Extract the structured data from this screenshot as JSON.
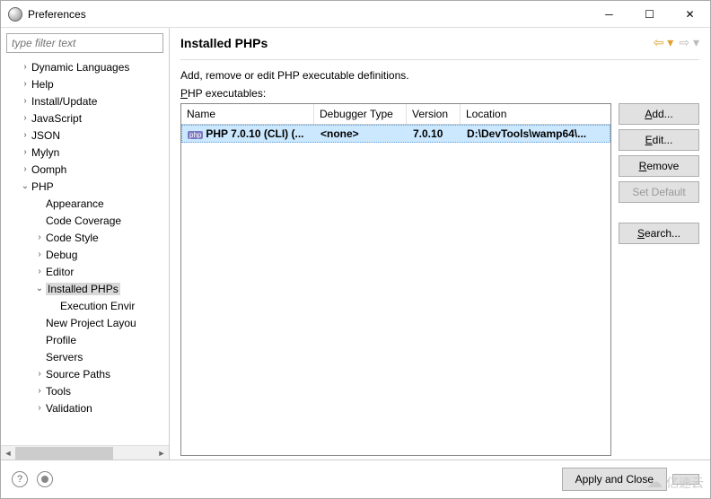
{
  "window": {
    "title": "Preferences"
  },
  "filter": {
    "placeholder": "type filter text"
  },
  "tree": [
    {
      "label": "Dynamic Languages",
      "level": 1,
      "expand": ">"
    },
    {
      "label": "Help",
      "level": 1,
      "expand": ">"
    },
    {
      "label": "Install/Update",
      "level": 1,
      "expand": ">"
    },
    {
      "label": "JavaScript",
      "level": 1,
      "expand": ">"
    },
    {
      "label": "JSON",
      "level": 1,
      "expand": ">"
    },
    {
      "label": "Mylyn",
      "level": 1,
      "expand": ">"
    },
    {
      "label": "Oomph",
      "level": 1,
      "expand": ">"
    },
    {
      "label": "PHP",
      "level": 1,
      "expand": "v"
    },
    {
      "label": "Appearance",
      "level": 2,
      "expand": ""
    },
    {
      "label": "Code Coverage",
      "level": 2,
      "expand": ""
    },
    {
      "label": "Code Style",
      "level": 2,
      "expand": ">"
    },
    {
      "label": "Debug",
      "level": 2,
      "expand": ">"
    },
    {
      "label": "Editor",
      "level": 2,
      "expand": ">"
    },
    {
      "label": "Installed PHPs",
      "level": 2,
      "expand": "v",
      "selected": true
    },
    {
      "label": "Execution Envir",
      "level": 3,
      "expand": ""
    },
    {
      "label": "New Project Layou",
      "level": 2,
      "expand": ""
    },
    {
      "label": "Profile",
      "level": 2,
      "expand": ""
    },
    {
      "label": "Servers",
      "level": 2,
      "expand": ""
    },
    {
      "label": "Source Paths",
      "level": 2,
      "expand": ">"
    },
    {
      "label": "Tools",
      "level": 2,
      "expand": ">"
    },
    {
      "label": "Validation",
      "level": 2,
      "expand": ">"
    }
  ],
  "panel": {
    "title": "Installed PHPs",
    "description": "Add, remove or edit PHP executable definitions.",
    "exe_label": "PHP executables:"
  },
  "table": {
    "headers": {
      "name": "Name",
      "debugger": "Debugger Type",
      "version": "Version",
      "location": "Location"
    },
    "rows": [
      {
        "badge": "php",
        "name": "PHP 7.0.10 (CLI) (...",
        "debugger": "<none>",
        "version": "7.0.10",
        "location": "D:\\DevTools\\wamp64\\...",
        "selected": true
      }
    ]
  },
  "buttons": {
    "add": "Add...",
    "edit": "Edit...",
    "remove": "Remove",
    "set_default": "Set Default",
    "search": "Search..."
  },
  "footer": {
    "apply_close": "Apply and Close"
  },
  "watermark": "亿速云"
}
